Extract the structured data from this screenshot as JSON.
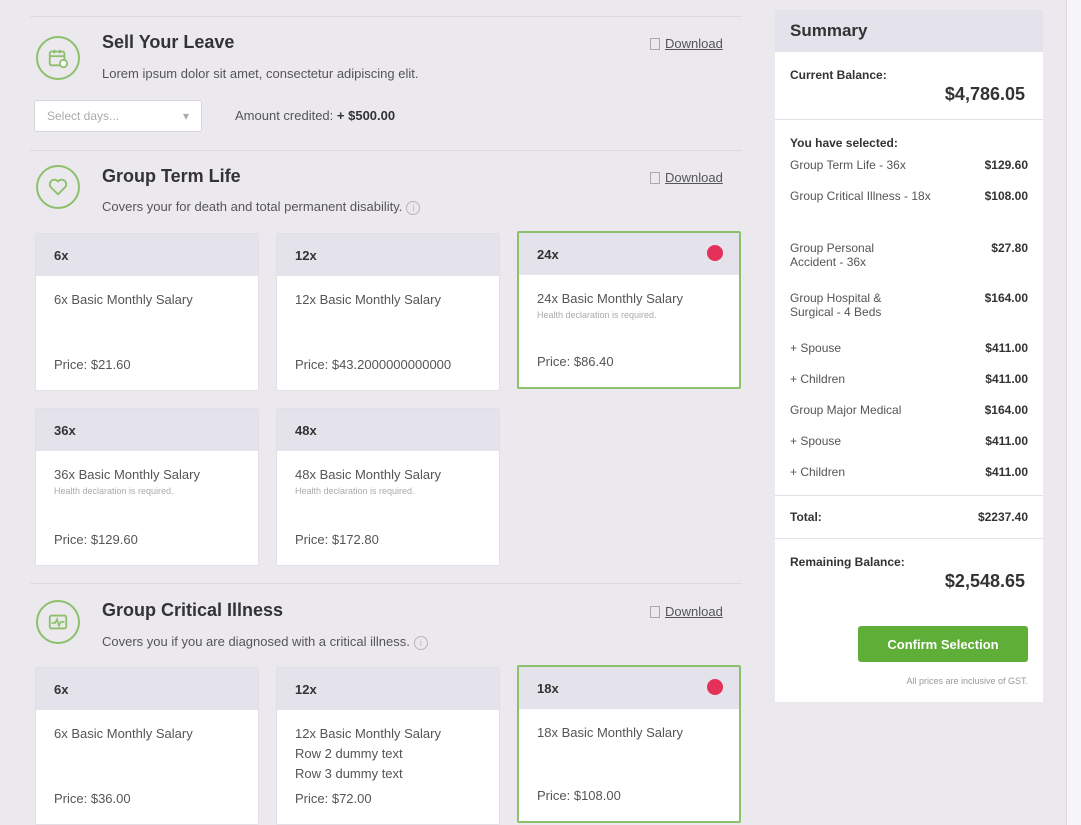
{
  "colors": {
    "accent_green": "#8cc06c",
    "button_green": "#5fae38",
    "selected_dot": "#e5305a",
    "header_gray": "#e4e2ea"
  },
  "sell_leave": {
    "title": "Sell Your Leave",
    "description": "Lorem ipsum dolor sit amet, consectetur adipiscing elit.",
    "download": "Download",
    "select_placeholder": "Select days...",
    "amount_label": "Amount credited:",
    "amount_value": "+ $500.00",
    "icon": "calendar-icon"
  },
  "group_term_life": {
    "title": "Group Term Life",
    "description": "Covers your for death and total permanent disability.",
    "download": "Download",
    "icon": "heart-icon",
    "cards": [
      {
        "head": "6x",
        "desc": "6x Basic Monthly Salary",
        "note": "",
        "price": "Price: $21.60",
        "selected": false
      },
      {
        "head": "12x",
        "desc": "12x Basic Monthly Salary",
        "note": "",
        "price": "Price: $43.2000000000000",
        "selected": false
      },
      {
        "head": "24x",
        "desc": "24x Basic Monthly Salary",
        "note": "Health declaration is required.",
        "price": "Price: $86.40",
        "selected": true
      },
      {
        "head": "36x",
        "desc": "36x Basic Monthly Salary",
        "note": "Health declaration is required.",
        "price": "Price: $129.60",
        "selected": false
      },
      {
        "head": "48x",
        "desc": "48x Basic Monthly Salary",
        "note": "Health declaration is required.",
        "price": "Price: $172.80",
        "selected": false
      }
    ]
  },
  "group_critical_illness": {
    "title": "Group Critical Illness",
    "description": "Covers you if you are diagnosed with a critical illness.",
    "download": "Download",
    "icon": "heart-monitor-icon",
    "cards": [
      {
        "head": "6x",
        "desc": "6x Basic Monthly Salary",
        "price": "Price: $36.00",
        "selected": false
      },
      {
        "head": "12x",
        "desc": "12x Basic Monthly Salary",
        "desc2": "Row 2 dummy text",
        "desc3": "Row 3 dummy text",
        "price": "Price: $72.00",
        "selected": false
      },
      {
        "head": "18x",
        "desc": "18x Basic Monthly Salary",
        "price": "Price: $108.00",
        "selected": true
      }
    ]
  },
  "summary": {
    "title": "Summary",
    "current_balance_label": "Current Balance:",
    "current_balance": "$4,786.05",
    "selected_label": "You have selected:",
    "items": [
      {
        "name": "Group Term Life - 36x",
        "value": "$129.60"
      },
      {
        "name": "Group Critical Illness - 18x",
        "value": "$108.00"
      },
      {
        "name": "Group Personal Accident - 36x",
        "value": "$27.80"
      },
      {
        "name": "Group Hospital & Surgical - 4 Beds",
        "value": "$164.00"
      },
      {
        "name": "+ Spouse",
        "value": "$411.00"
      },
      {
        "name": "+ Children",
        "value": "$411.00"
      },
      {
        "name": "Group Major Medical",
        "value": "$164.00"
      },
      {
        "name": "+ Spouse",
        "value": "$411.00"
      },
      {
        "name": "+ Children",
        "value": "$411.00"
      }
    ],
    "total_label": "Total:",
    "total_value": "$2237.40",
    "remaining_label": "Remaining Balance:",
    "remaining_value": "$2,548.65",
    "confirm_label": "Confirm Selection",
    "gst_note": "All prices are inclusive of GST."
  }
}
